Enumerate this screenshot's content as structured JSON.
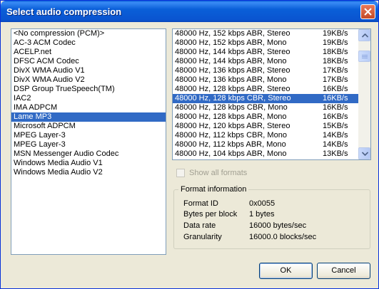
{
  "window": {
    "title": "Select audio compression"
  },
  "codecs": {
    "items": [
      "<No compression (PCM)>",
      "AC-3 ACM Codec",
      "ACELP.net",
      "DFSC ACM Codec",
      "DivX WMA Audio V1",
      "DivX WMA Audio V2",
      "DSP Group TrueSpeech(TM)",
      "IAC2",
      "IMA ADPCM",
      "Lame MP3",
      "Microsoft ADPCM",
      "MPEG Layer-3",
      "MPEG Layer-3",
      "MSN Messenger Audio Codec",
      "Windows Media Audio V1",
      "Windows Media Audio V2"
    ],
    "selected_index": 9
  },
  "formats": {
    "items": [
      {
        "name": "48000 Hz, 152 kbps ABR, Stereo",
        "rate": "19KB/s"
      },
      {
        "name": "48000 Hz, 152 kbps ABR, Mono",
        "rate": "19KB/s"
      },
      {
        "name": "48000 Hz, 144 kbps ABR, Stereo",
        "rate": "18KB/s"
      },
      {
        "name": "48000 Hz, 144 kbps ABR, Mono",
        "rate": "18KB/s"
      },
      {
        "name": "48000 Hz, 136 kbps ABR, Stereo",
        "rate": "17KB/s"
      },
      {
        "name": "48000 Hz, 136 kbps ABR, Mono",
        "rate": "17KB/s"
      },
      {
        "name": "48000 Hz, 128 kbps ABR, Stereo",
        "rate": "16KB/s"
      },
      {
        "name": "48000 Hz, 128 kbps CBR, Stereo",
        "rate": "16KB/s"
      },
      {
        "name": "48000 Hz, 128 kbps CBR, Mono",
        "rate": "16KB/s"
      },
      {
        "name": "48000 Hz, 128 kbps ABR, Mono",
        "rate": "16KB/s"
      },
      {
        "name": "48000 Hz, 120 kbps ABR, Stereo",
        "rate": "15KB/s"
      },
      {
        "name": "48000 Hz, 112 kbps CBR, Mono",
        "rate": "14KB/s"
      },
      {
        "name": "48000 Hz, 112 kbps ABR, Mono",
        "rate": "14KB/s"
      },
      {
        "name": "48000 Hz, 104 kbps ABR, Mono",
        "rate": "13KB/s"
      }
    ],
    "selected_index": 7,
    "scroll_position": 0.1
  },
  "show_all_formats": {
    "label": "Show all formats",
    "checked": false,
    "enabled": false
  },
  "format_info": {
    "title": "Format information",
    "rows": [
      {
        "label": "Format ID",
        "value": "0x0055"
      },
      {
        "label": "Bytes per block",
        "value": "1 bytes"
      },
      {
        "label": "Data rate",
        "value": "16000 bytes/sec"
      },
      {
        "label": "Granularity",
        "value": "16000.0 blocks/sec"
      }
    ]
  },
  "buttons": {
    "ok": "OK",
    "cancel": "Cancel"
  },
  "colors": {
    "title_bar": "#0a5fd8",
    "selection": "#316ac5",
    "dialog_bg": "#ece9d8"
  }
}
